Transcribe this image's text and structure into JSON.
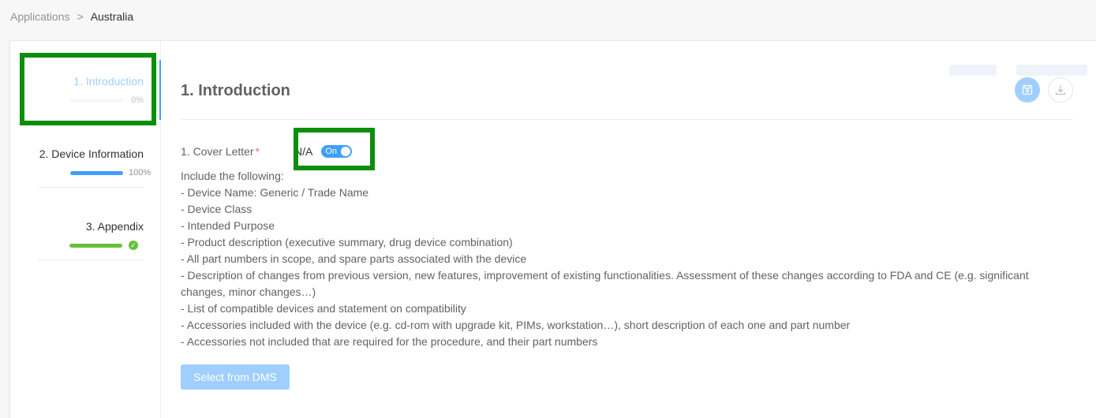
{
  "breadcrumb": {
    "root": "Applications",
    "separator": ">",
    "current": "Australia"
  },
  "sidebar": {
    "steps": [
      {
        "label": "1. Introduction",
        "progress_text": "0%",
        "progress": 0,
        "status": "active"
      },
      {
        "label": "2. Device Information",
        "progress_text": "100%",
        "progress": 100,
        "status": "done"
      },
      {
        "label": "3. Appendix",
        "progress_text": "",
        "progress": 100,
        "status": "complete"
      }
    ]
  },
  "main": {
    "title": "1. Introduction",
    "icons": {
      "save": "save-icon",
      "download": "download-icon"
    },
    "field": {
      "label": "1. Cover Letter",
      "required_mark": "*",
      "na_label": "N/A",
      "toggle_text": "On"
    },
    "instructions": [
      "Include the following:",
      "- Device Name: Generic / Trade Name",
      "- Device Class",
      "- Intended Purpose",
      "- Product description (executive summary, drug device combination)",
      "- All part numbers in scope, and spare parts associated with the device",
      "- Description of changes from previous version, new features, improvement of existing functionalities. Assessment of these changes according to FDA and CE (e.g. significant changes, minor changes…)",
      "- List of compatible devices and statement on compatibility",
      "- Accessories included with the device (e.g. cd-rom with upgrade kit, PIMs, workstation…), short description of each one and part number",
      "- Accessories not included that are required for the procedure, and their part numbers"
    ],
    "dms_button": "Select from DMS"
  },
  "colors": {
    "primary": "#409eff",
    "primary_light": "#a0cfff",
    "success": "#67c23a",
    "highlight": "#0b8f0b",
    "required": "#f56c6c"
  }
}
